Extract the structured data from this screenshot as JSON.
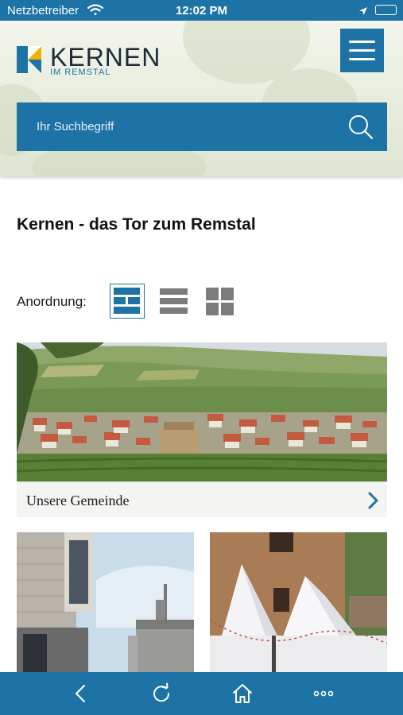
{
  "status_bar": {
    "carrier": "Netzbetreiber",
    "time": "12:02 PM",
    "icons": [
      "wifi-icon",
      "location-arrow-icon",
      "battery-icon"
    ]
  },
  "header": {
    "logo": {
      "name": "KERNEN",
      "subtitle": "IM REMSTAL"
    },
    "menu_icon": "hamburger-icon",
    "search": {
      "placeholder": "Ihr Suchbegriff",
      "icon": "search-icon"
    }
  },
  "main": {
    "title": "Kernen - das Tor zum Remstal",
    "arrangement": {
      "label": "Anordnung:",
      "options": [
        {
          "name": "layout-featured-icon",
          "active": true
        },
        {
          "name": "layout-list-icon",
          "active": false
        },
        {
          "name": "layout-grid-icon",
          "active": false
        }
      ]
    },
    "cards": [
      {
        "caption": "Unsere Gemeinde",
        "icon": "chevron-right-icon"
      }
    ]
  },
  "bottom_bar": {
    "items": [
      "back-icon",
      "reload-icon",
      "home-icon",
      "more-icon"
    ]
  },
  "colors": {
    "accent": "#1d73a6",
    "text": "#111111",
    "icon_gray": "#7c7c7c"
  }
}
